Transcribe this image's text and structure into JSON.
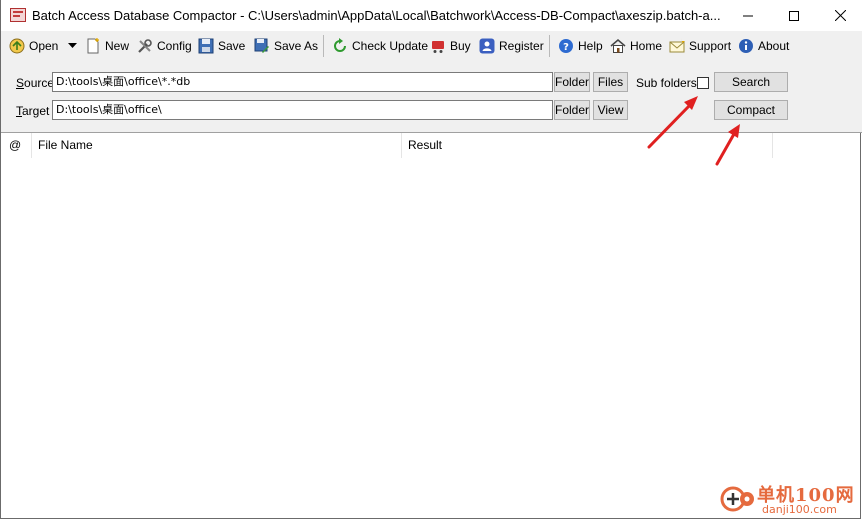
{
  "window": {
    "title": "Batch Access Database Compactor - C:\\Users\\admin\\AppData\\Local\\Batchwork\\Access-DB-Compact\\axeszip.batch-a..."
  },
  "toolbar": {
    "open": "Open",
    "new": "New",
    "config": "Config",
    "save": "Save",
    "save_as": "Save As",
    "check_update": "Check Update",
    "buy": "Buy",
    "register": "Register",
    "help": "Help",
    "home": "Home",
    "support": "Support",
    "about": "About"
  },
  "source": {
    "label": "Source",
    "value": "D:\\tools\\桌面\\office\\*.*db",
    "folder_btn": "Folder",
    "files_btn": "Files",
    "subfolders_label": "Sub folders",
    "subfolders_checked": false,
    "search_btn": "Search"
  },
  "target": {
    "label": "Target",
    "value": "D:\\tools\\桌面\\office\\",
    "folder_btn": "Folder",
    "view_btn": "View",
    "compact_btn": "Compact"
  },
  "list": {
    "columns": [
      "@",
      "File Name",
      "Result"
    ]
  },
  "watermark": {
    "cn": "单机100网",
    "en": "danji100.com"
  },
  "colors": {
    "accent_arrow": "#e02020",
    "watermark": "#e56a3e"
  }
}
